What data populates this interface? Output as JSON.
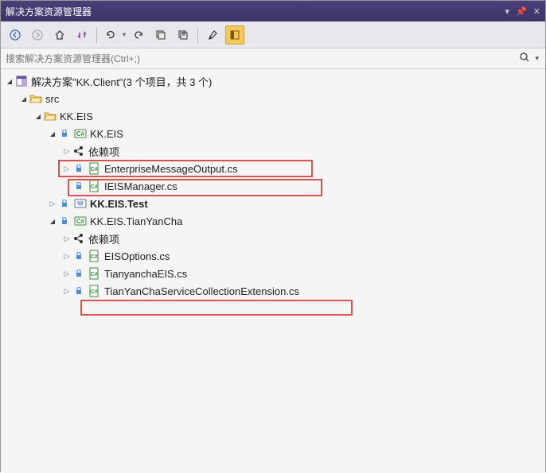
{
  "titlebar": {
    "title": "解决方案资源管理器"
  },
  "search": {
    "placeholder": "搜索解决方案资源管理器(Ctrl+;)"
  },
  "tree": {
    "solution": "解决方案\"KK.Client\"(3 个项目，共 3 个)",
    "src": "src",
    "kkeis_folder": "KK.EIS",
    "kkeis_proj": "KK.EIS",
    "deps1": "依赖项",
    "file_emo": "EnterpriseMessageOutput.cs",
    "file_ieis": "IEISManager.cs",
    "kkeis_test": "KK.EIS.Test",
    "kkeis_tyc": "KK.EIS.TianYanCha",
    "deps2": "依赖项",
    "file_opts": "EISOptions.cs",
    "file_tyeis": "TianyanchaEIS.cs",
    "file_tysce": "TianYanChaServiceCollectionExtension.cs"
  }
}
